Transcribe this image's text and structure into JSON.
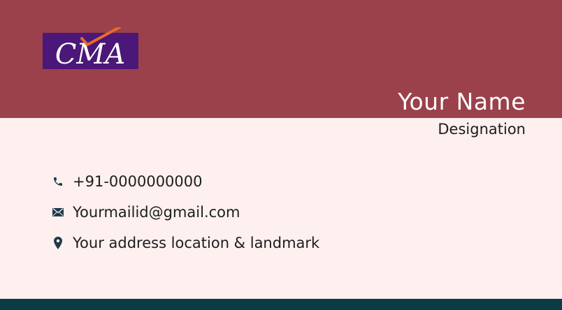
{
  "brand": {
    "logo_text": "CMA",
    "logo_bg": "#4b1778",
    "check_color": "#e86a2b"
  },
  "card": {
    "name": "Your Name",
    "designation": "Designation",
    "phone": "+91-0000000000",
    "email": "Yourmailid@gmail.com",
    "address": "Your address location & landmark"
  },
  "icons": {
    "phone": "phone-icon",
    "email": "mail-icon",
    "address": "location-pin-icon"
  },
  "colors": {
    "header": "#9b414c",
    "body": "#fdf0ef",
    "footer": "#0b3c45",
    "icon": "#1f3a4a"
  }
}
